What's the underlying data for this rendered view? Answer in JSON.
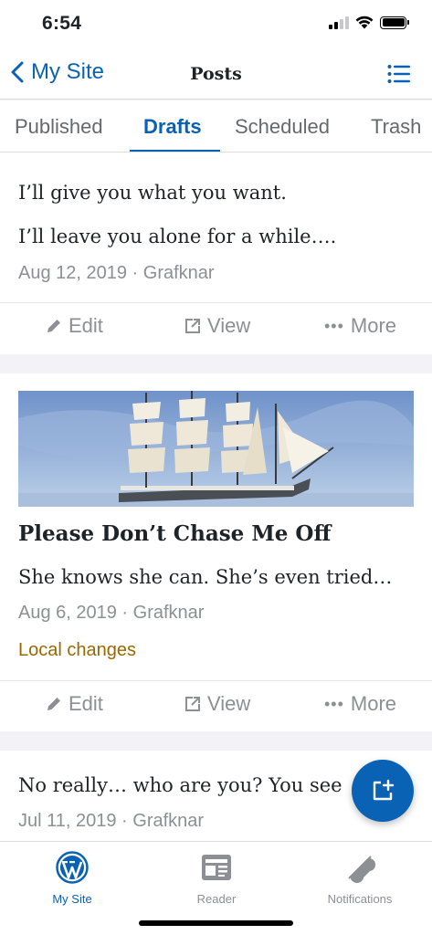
{
  "status_bar": {
    "time": "6:54"
  },
  "nav": {
    "back_label": "My Site",
    "title": "Posts"
  },
  "tabs": [
    {
      "label": "Published",
      "active": false
    },
    {
      "label": "Drafts",
      "active": true
    },
    {
      "label": "Scheduled",
      "active": false
    },
    {
      "label": "Trash",
      "active": false
    }
  ],
  "posts": [
    {
      "excerpt_lines": [
        "I’ll give you what you want.",
        "I’ll leave you alone for a while…."
      ],
      "date": "Aug 12, 2019",
      "author": "Grafknar",
      "meta": "Aug 12, 2019 · Grafknar"
    },
    {
      "title": "Please Don’t Chase Me Off",
      "excerpt": "She knows she can. She’s even tried…",
      "date": "Aug 6, 2019",
      "author": "Grafknar",
      "meta": "Aug 6, 2019 · Grafknar",
      "status": "Local changes"
    },
    {
      "excerpt": "No really… who are you? You see",
      "date": "Jul 11, 2019",
      "author": "Grafknar",
      "meta": "Jul 11, 2019 · Grafknar"
    }
  ],
  "actions": {
    "edit": "Edit",
    "view": "View",
    "more": "More"
  },
  "tab_bar": [
    {
      "label": "My Site",
      "icon": "wordpress-icon",
      "active": true
    },
    {
      "label": "Reader",
      "icon": "reader-icon",
      "active": false
    },
    {
      "label": "Notifications",
      "icon": "bell-icon",
      "active": false
    }
  ],
  "colors": {
    "accent": "#0a62b5",
    "local_changes": "#996800",
    "meta": "#8c8f94"
  }
}
